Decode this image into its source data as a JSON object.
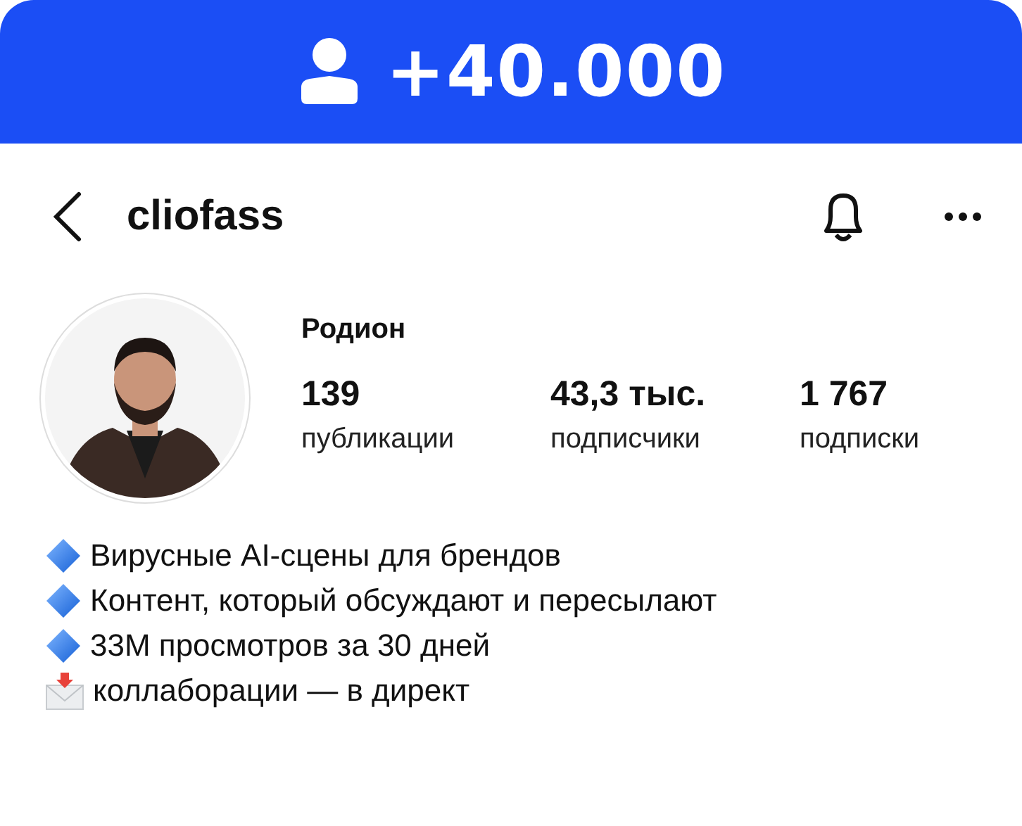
{
  "banner": {
    "text": "+40.000"
  },
  "header": {
    "username": "cliofass"
  },
  "profile": {
    "name": "Родион",
    "stats": [
      {
        "value": "139",
        "label": "публикации"
      },
      {
        "value": "43,3 тыс.",
        "label": "подписчики"
      },
      {
        "value": "1 767",
        "label": "подписки"
      }
    ]
  },
  "bio": [
    {
      "kind": "diamond",
      "text": "Вирусные AI-сцены для брендов"
    },
    {
      "kind": "diamond",
      "text": "Контент, который обсуждают и пересылают"
    },
    {
      "kind": "diamond",
      "text": "33M просмотров за 30 дней"
    },
    {
      "kind": "envelope",
      "text": "коллаборации — в директ"
    }
  ]
}
